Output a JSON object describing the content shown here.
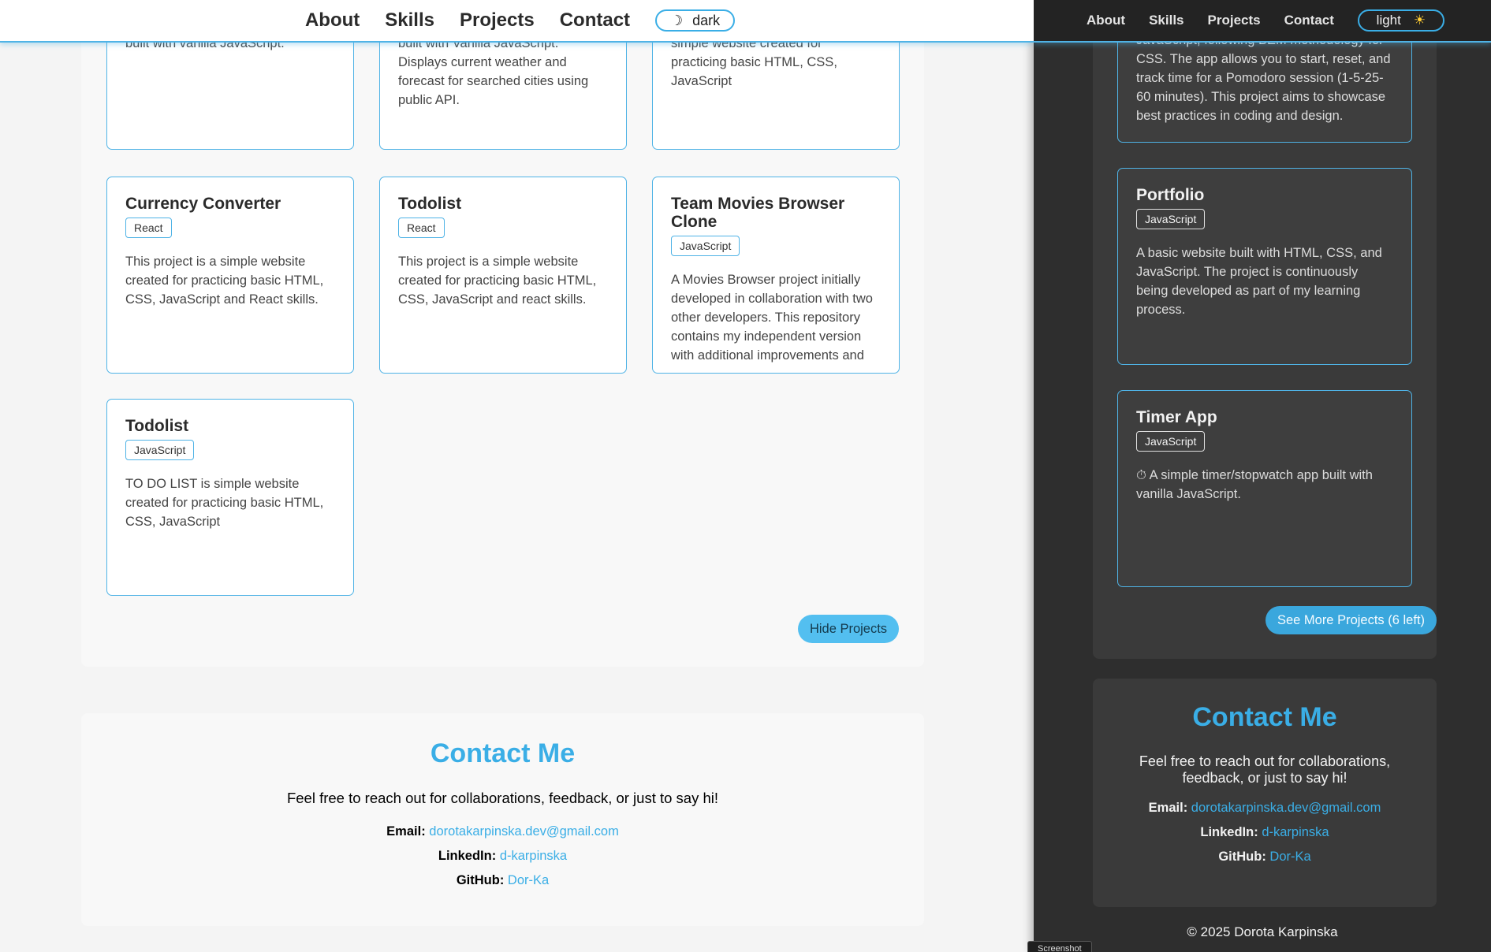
{
  "light": {
    "nav": {
      "items": [
        "About",
        "Skills",
        "Projects",
        "Contact"
      ],
      "toggle_icon": "☽",
      "toggle_label": "dark"
    },
    "cards_top": [
      {
        "desc": "A simple timer/stopwatch app built with vanilla JavaScript.",
        "icon": "stopwatch-icon"
      },
      {
        "desc": "Simple weather forecast application built with Vanilla JavaScript. Displays current weather and forecast for searched cities using public API."
      },
      {
        "desc": "CURRENCY CONVERTER is simple website created for practicing basic HTML, CSS, JavaScript"
      }
    ],
    "cards": [
      {
        "title": "Currency Converter",
        "tag": "React",
        "desc": "This project is a simple website created for practicing basic HTML, CSS, JavaScript and React skills."
      },
      {
        "title": "Todolist",
        "tag": "React",
        "desc": "This project is a simple website created for practicing basic HTML, CSS, JavaScript and react skills."
      },
      {
        "title": "Team Movies Browser Clone",
        "tag": "JavaScript",
        "desc": "A Movies Browser project initially developed in collaboration with two other developers. This repository contains my independent version with additional improvements and"
      },
      {
        "title": "Todolist",
        "tag": "JavaScript",
        "desc": "TO DO LIST is simple website created for practicing basic HTML, CSS, JavaScript"
      }
    ],
    "hide_button": "Hide Projects",
    "contact": {
      "title": "Contact Me",
      "intro": "Feel free to reach out for collaborations, feedback, or just to say hi!",
      "email_label": "Email:",
      "email": "dorotakarpinska.dev@gmail.com",
      "linkedin_label": "LinkedIn:",
      "linkedin": "d-karpinska",
      "github_label": "GitHub:",
      "github": "Dor-Ka"
    }
  },
  "dark": {
    "nav": {
      "items": [
        "About",
        "Skills",
        "Projects",
        "Contact"
      ],
      "toggle_label": "light",
      "toggle_icon": "☀"
    },
    "card_top_desc": "JavaScript, following BEM methodology for CSS. The app allows you to start, reset, and track time for a Pomodoro session (1-5-25-60 minutes). This project aims to showcase best practices in coding and design.",
    "cards": [
      {
        "title": "Portfolio",
        "tag": "JavaScript",
        "desc": "A basic website built with HTML, CSS, and JavaScript. The project is continuously being developed as part of my learning process."
      },
      {
        "title": "Timer App",
        "tag": "JavaScript",
        "desc": "A simple timer/stopwatch app built with vanilla JavaScript.",
        "icon": "⏱"
      }
    ],
    "more_button": "See More Projects (6 left)",
    "contact": {
      "title": "Contact Me",
      "intro": "Feel free to reach out for collaborations, feedback, or just to say hi!",
      "email_label": "Email:",
      "email": "dorotakarpinska.dev@gmail.com",
      "linkedin_label": "LinkedIn:",
      "linkedin": "d-karpinska",
      "github_label": "GitHub:",
      "github": "Dor-Ka"
    },
    "footer": "© 2025 Dorota Karpinska"
  },
  "tooltip": "Screenshot",
  "colors": {
    "accent": "#4fb3e6",
    "button": "#53bff0",
    "dark_bg": "#2e2e2e",
    "light_bg": "#f4f4f4"
  }
}
